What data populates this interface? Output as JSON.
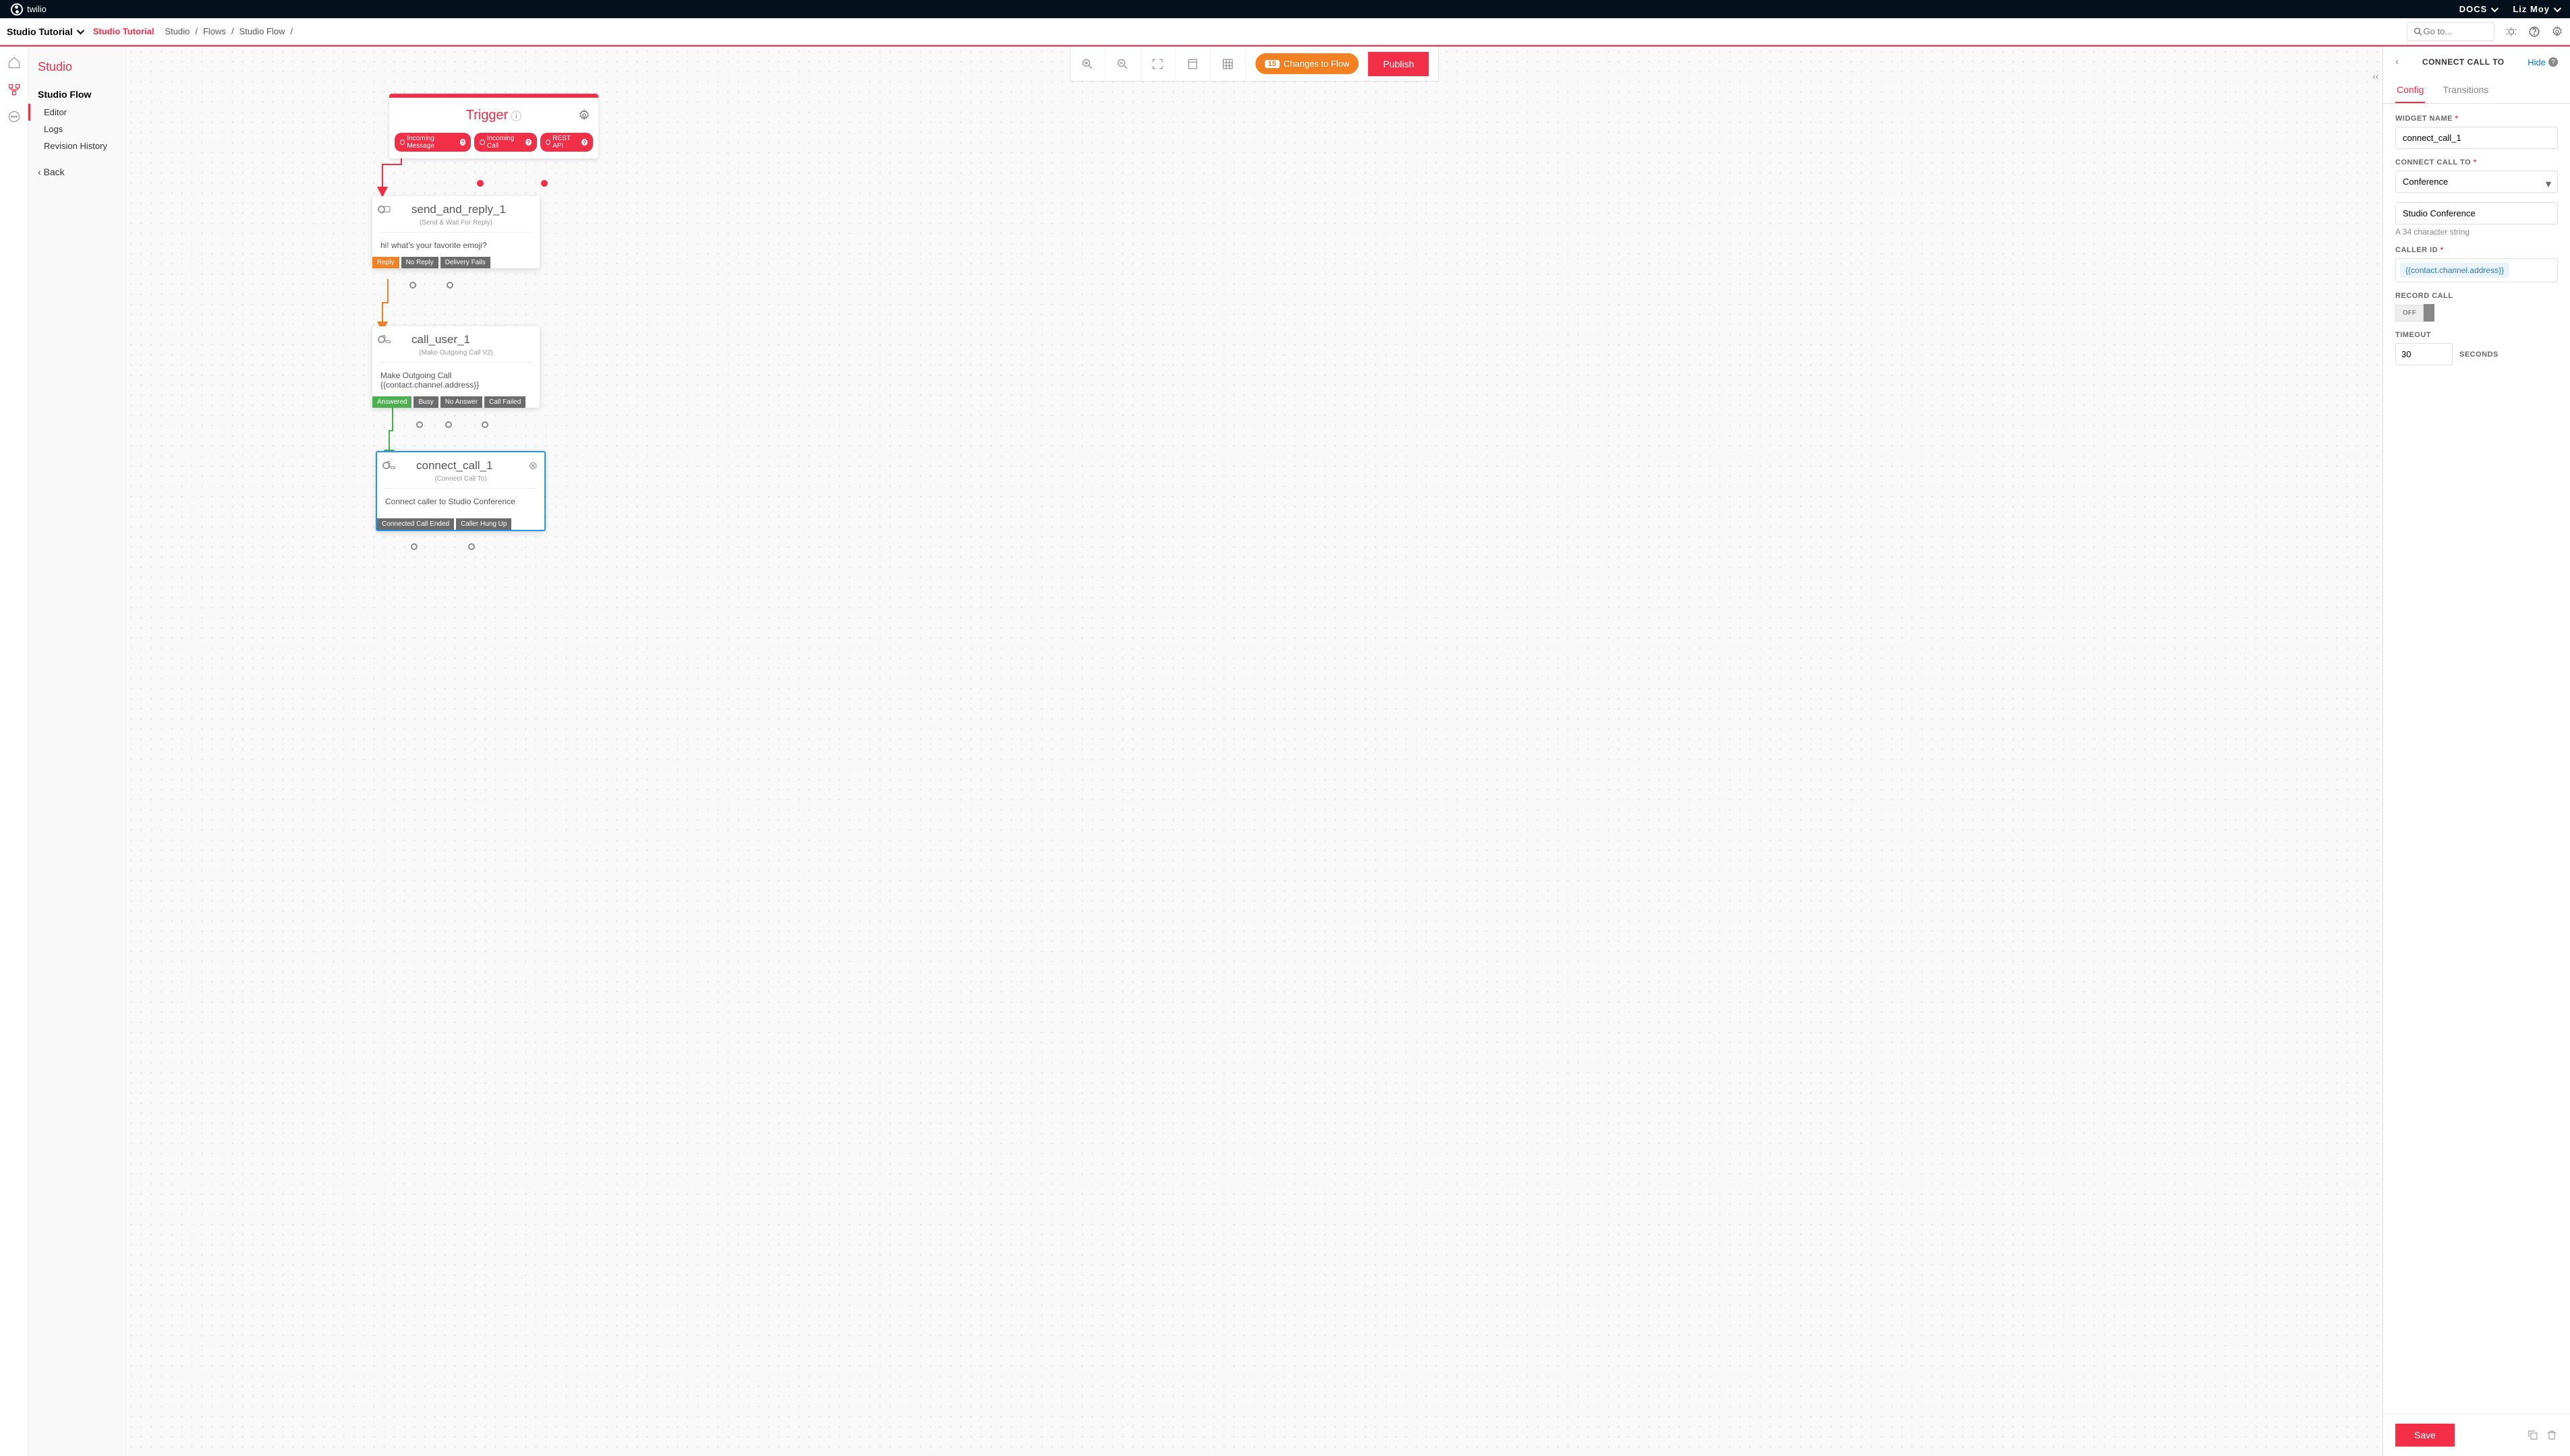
{
  "topbar": {
    "brand": "twilio",
    "docs": "DOCS",
    "user": "Liz Moy"
  },
  "navbar": {
    "title": "Studio Tutorial",
    "link": "Studio Tutorial",
    "crumbs": [
      "Studio",
      "Flows",
      "Studio Flow"
    ],
    "search_placeholder": "Go to..."
  },
  "sidebar": {
    "heading": "Studio",
    "section": "Studio Flow",
    "items": [
      "Editor",
      "Logs",
      "Revision History"
    ],
    "back": "Back"
  },
  "toolbar": {
    "changes_count": "15",
    "changes_label": "Changes to Flow",
    "publish": "Publish"
  },
  "trigger": {
    "title": "Trigger",
    "pills": [
      "Incoming Message",
      "Incoming Call",
      "REST API"
    ]
  },
  "widget1": {
    "name": "send_and_reply_1",
    "type": "(Send & Wait For Reply)",
    "body": "hi! what's your favorite emoji?",
    "outputs": [
      "Reply",
      "No Reply",
      "Delivery Fails"
    ]
  },
  "widget2": {
    "name": "call_user_1",
    "type": "(Make Outgoing Call V2)",
    "body_l1": "Make Outgoing Call",
    "body_l2": "{{contact.channel.address}}",
    "outputs": [
      "Answered",
      "Busy",
      "No Answer",
      "Call Failed"
    ]
  },
  "widget3": {
    "name": "connect_call_1",
    "type": "(Connect Call To)",
    "body": "Connect caller to Studio Conference",
    "outputs": [
      "Connected Call Ended",
      "Caller Hung Up"
    ]
  },
  "panel": {
    "title": "CONNECT CALL TO",
    "hide": "Hide",
    "tabs": [
      "Config",
      "Transitions"
    ],
    "widget_name_label": "WIDGET NAME",
    "widget_name_value": "connect_call_1",
    "connect_label": "CONNECT CALL TO",
    "connect_value": "Conference",
    "conf_name_value": "Studio Conference",
    "conf_hint": "A 34 character string",
    "caller_id_label": "CALLER ID",
    "caller_id_value": "{{contact.channel.address}}",
    "record_label": "RECORD CALL",
    "record_value": "OFF",
    "timeout_label": "TIMEOUT",
    "timeout_value": "30",
    "timeout_unit": "SECONDS",
    "save": "Save"
  }
}
